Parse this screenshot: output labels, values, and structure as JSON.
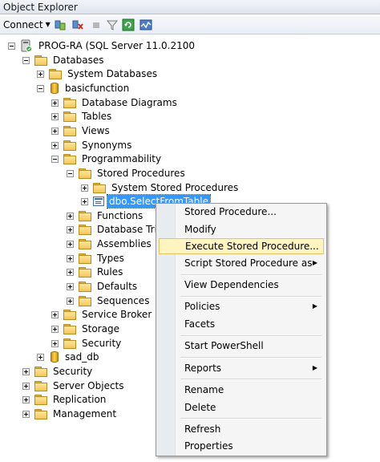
{
  "window": {
    "title": "Object Explorer"
  },
  "toolbar": {
    "connect_label": "Connect",
    "icons": [
      "connect-object-explorer-icon",
      "disconnect-icon",
      "stop-icon",
      "filter-icon",
      "refresh-icon",
      "activity-monitor-icon"
    ]
  },
  "tree": {
    "server": "PROG-RA (SQL Server 11.0.2100",
    "databases": "Databases",
    "system_databases": "System Databases",
    "basicfunction": "basicfunction",
    "database_diagrams": "Database Diagrams",
    "tables": "Tables",
    "views": "Views",
    "synonyms": "Synonyms",
    "programmability": "Programmability",
    "stored_procedures": "Stored Procedures",
    "system_stored_procedures": "System Stored Procedures",
    "selected_procedure": "dbo.SelectFromTable",
    "functions": "Functions",
    "database_triggers": "Database Trigg",
    "assemblies": "Assemblies",
    "types": "Types",
    "rules": "Rules",
    "defaults": "Defaults",
    "sequences": "Sequences",
    "service_broker": "Service Broker",
    "storage": "Storage",
    "security_db": "Security",
    "sad_db": "sad_db",
    "security": "Security",
    "server_objects": "Server Objects",
    "replication": "Replication",
    "management": "Management"
  },
  "context_menu": {
    "new_stored_procedure": "Stored Procedure...",
    "modify": "Modify",
    "execute": "Execute Stored Procedure...",
    "script_as": "Script Stored Procedure as",
    "view_dependencies": "View Dependencies",
    "policies": "Policies",
    "facets": "Facets",
    "start_powershell": "Start PowerShell",
    "reports": "Reports",
    "rename": "Rename",
    "delete": "Delete",
    "refresh": "Refresh",
    "properties": "Properties",
    "highlighted_item": "Execute Stored Procedure..."
  },
  "colors": {
    "selection": "#3399ff",
    "menu_highlight": "#fdf4bf",
    "folder": "#f2c75a"
  }
}
